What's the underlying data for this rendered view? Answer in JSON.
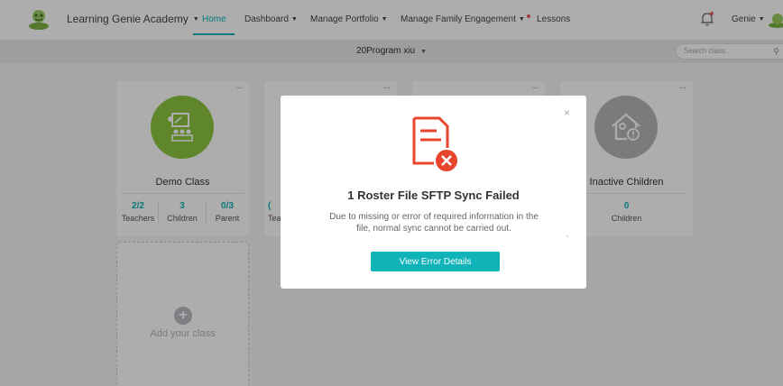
{
  "header": {
    "brand": "Learning Genie Academy",
    "nav": [
      {
        "label": "Home",
        "active": true
      },
      {
        "label": "Dashboard",
        "dropdown": true
      },
      {
        "label": "Manage Portfolio",
        "dropdown": true
      },
      {
        "label": "Manage Family Engagement",
        "dropdown": true,
        "dot": true
      },
      {
        "label": "Lessons"
      }
    ],
    "user": "Genie"
  },
  "subbar": {
    "program": "20Program xiu",
    "search_placeholder": "Search class..."
  },
  "cards": [
    {
      "title": "Demo Class",
      "icon": "classroom-icon",
      "color": "#8dc63f",
      "stats": [
        {
          "value": "2/2",
          "label": "Teachers"
        },
        {
          "value": "3",
          "label": "Children"
        },
        {
          "value": "0/3",
          "label": "Parent"
        }
      ]
    },
    {
      "title": "Inactive Children",
      "icon": "inactive-house-icon",
      "color": "#b3b6b9",
      "stats": [
        {
          "value": "0",
          "label": "Children"
        }
      ]
    }
  ],
  "hidden_card": {
    "stat_label_partial": "Tea",
    "stat_value_partial": "("
  },
  "add_card": {
    "label": "Add your class"
  },
  "modal": {
    "title": "1 Roster File SFTP Sync Failed",
    "message": "Due to missing or error of required information in the file, normal sync cannot be carried out.",
    "button": "View Error Details",
    "close": "×"
  },
  "colors": {
    "accent": "#10b3b7",
    "error": "#e8452f"
  }
}
